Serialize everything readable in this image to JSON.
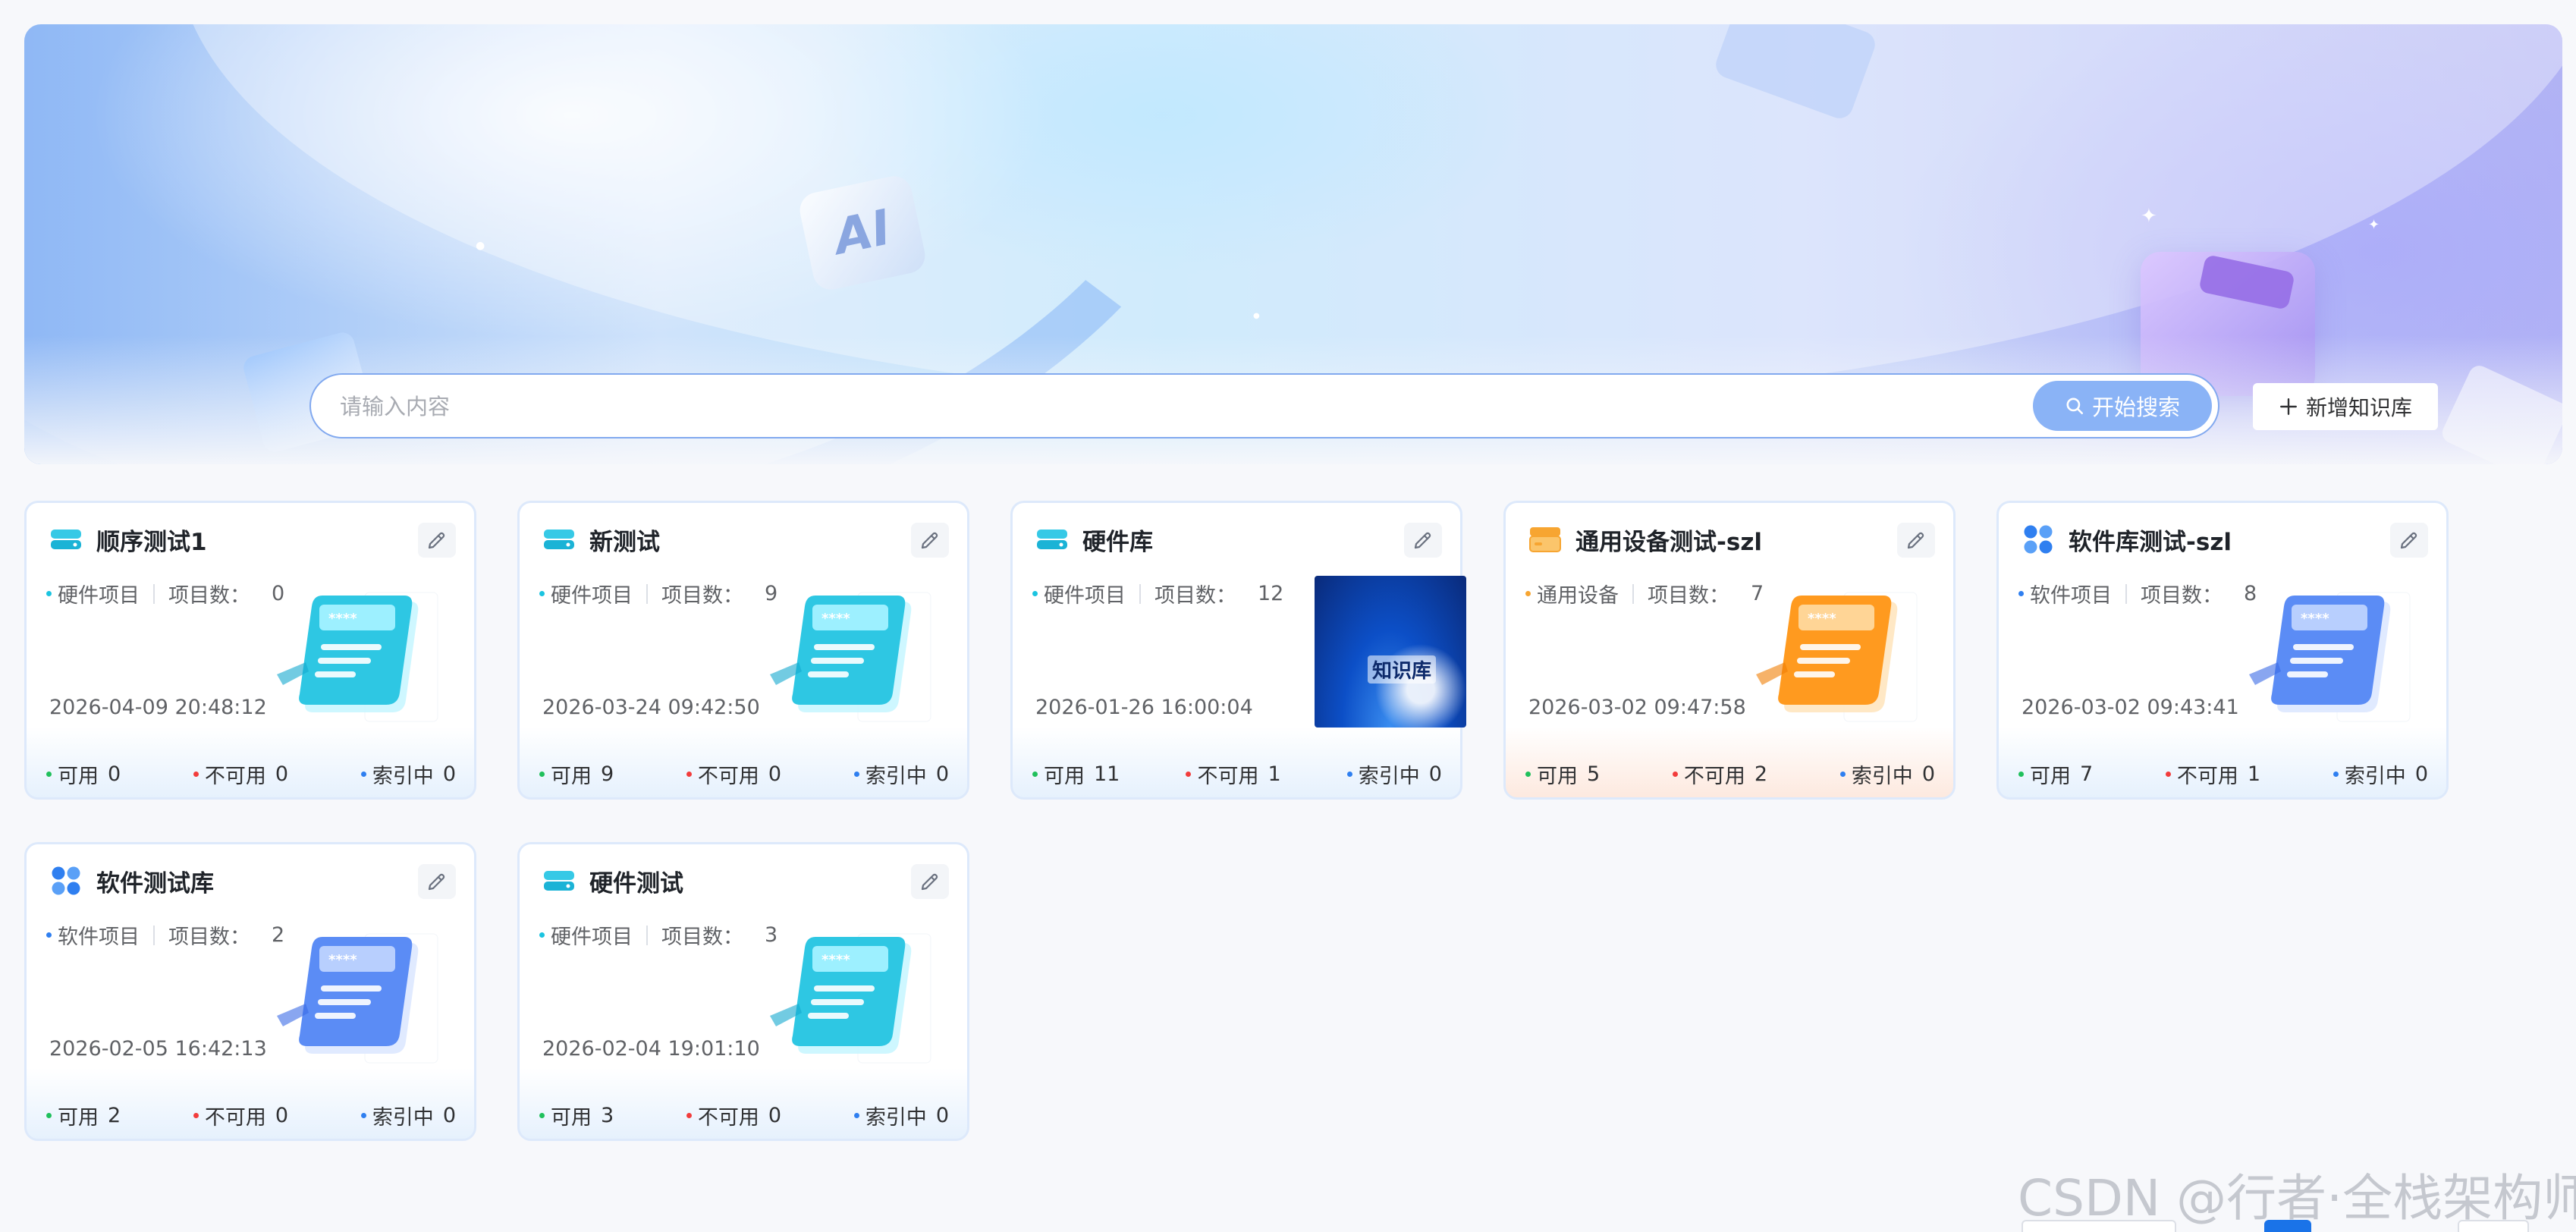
{
  "search": {
    "placeholder": "请输入内容",
    "button_label": "开始搜索"
  },
  "toolbar": {
    "add_label": "新增知识库"
  },
  "banner": {
    "badge_text": "AI"
  },
  "labels": {
    "project_count": "项目数：",
    "available": "可用",
    "unavailable": "不可用",
    "indexing": "索引中"
  },
  "colors": {
    "accent": "#8ab3f6",
    "border": "#82a9ef",
    "available_dot": "#20c05c",
    "unavailable_dot": "#f23c3c",
    "indexing_dot": "#2f7ff0",
    "hardware_icon": "#1bc4e0",
    "software_icon": "#2f7ff0",
    "general_icon": "#f7a531"
  },
  "cards": [
    {
      "title": "顺序测试1",
      "type": "硬件项目",
      "type_dot_color": "#1bc4e0",
      "icon": "hardware-drive-icon",
      "count": "0",
      "date": "2026-04-09 20:48:12",
      "available": "0",
      "unavailable": "0",
      "indexing": "0",
      "thumb": "cyan-document"
    },
    {
      "title": "新测试",
      "type": "硬件项目",
      "type_dot_color": "#1bc4e0",
      "icon": "hardware-drive-icon",
      "count": "9",
      "date": "2026-03-24 09:42:50",
      "available": "9",
      "unavailable": "0",
      "indexing": "0",
      "thumb": "cyan-document"
    },
    {
      "title": "硬件库",
      "type": "硬件项目",
      "type_dot_color": "#1bc4e0",
      "icon": "hardware-drive-icon",
      "count": "12",
      "date": "2026-01-26 16:00:04",
      "available": "11",
      "unavailable": "1",
      "indexing": "0",
      "thumb": "photo",
      "thumb_text": "知识库"
    },
    {
      "title": "通用设备测试-szl",
      "type": "通用设备",
      "type_dot_color": "#f7a531",
      "icon": "general-device-icon",
      "count": "7",
      "date": "2026-03-02 09:47:58",
      "available": "5",
      "unavailable": "2",
      "indexing": "0",
      "thumb": "orange-document"
    },
    {
      "title": "软件库测试-szl",
      "type": "软件项目",
      "type_dot_color": "#2f7ff0",
      "icon": "software-grid-icon",
      "count": "8",
      "date": "2026-03-02 09:43:41",
      "available": "7",
      "unavailable": "1",
      "indexing": "0",
      "thumb": "blue-document"
    },
    {
      "title": "软件测试库",
      "type": "软件项目",
      "type_dot_color": "#2f7ff0",
      "icon": "software-grid-icon",
      "count": "2",
      "date": "2026-02-05 16:42:13",
      "available": "2",
      "unavailable": "0",
      "indexing": "0",
      "thumb": "blue-document"
    },
    {
      "title": "硬件测试",
      "type": "硬件项目",
      "type_dot_color": "#1bc4e0",
      "icon": "hardware-drive-icon",
      "count": "3",
      "date": "2026-02-04 19:01:10",
      "available": "3",
      "unavailable": "0",
      "indexing": "0",
      "thumb": "cyan-document"
    }
  ],
  "watermark": "CSDN @行者·全栈架构师"
}
